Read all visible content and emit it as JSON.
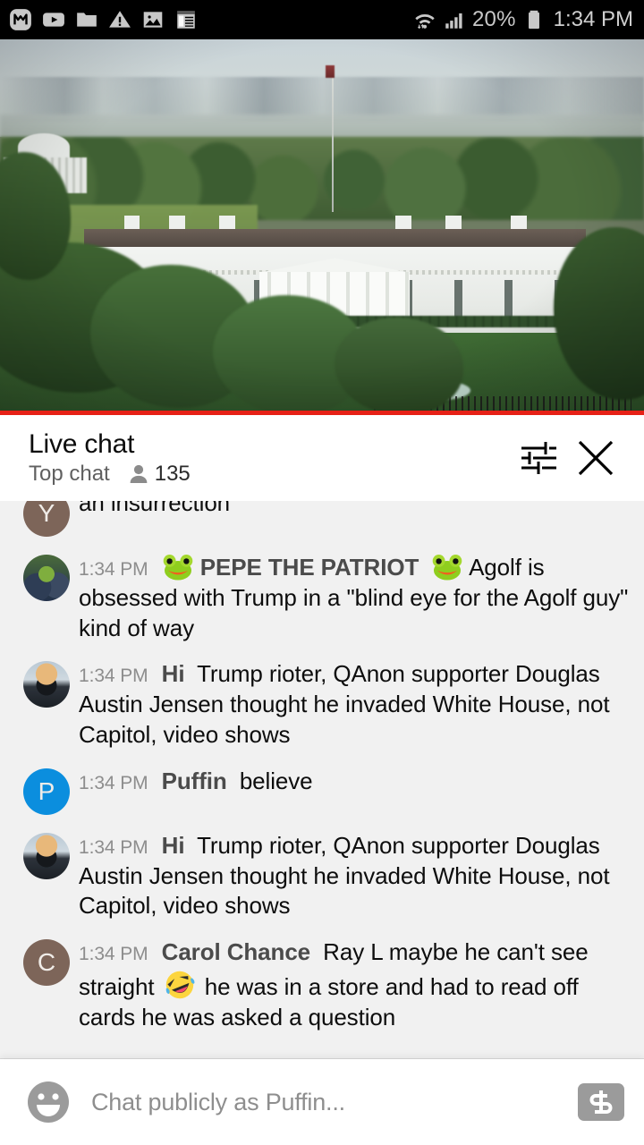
{
  "status_bar": {
    "left_icons": [
      "messenger-icon",
      "youtube-icon",
      "folder-icon",
      "warning-triangle-icon",
      "photo-icon",
      "notepad-icon"
    ],
    "wifi_icon": "wifi-icon",
    "signal_icon": "cell-signal-icon",
    "battery_percent": "20%",
    "battery_icon": "battery-icon",
    "clock": "1:34 PM",
    "background": "#000000",
    "text_color": "#c8c8c8"
  },
  "video": {
    "description": "White House live stream",
    "progress_bar_color": "#e62117",
    "progress_percent": 100
  },
  "chat_header": {
    "title": "Live chat",
    "subtitle": "Top chat",
    "viewer_count": "135",
    "viewer_icon": "person-icon",
    "settings_icon": "tune-sliders-icon",
    "close_icon": "close-x-icon"
  },
  "messages": [
    {
      "clipped": true,
      "avatar_type": "letter",
      "avatar_letter": "Y",
      "avatar_color": "#7d6559",
      "timestamp": "",
      "author": "",
      "text": "an insurrection"
    },
    {
      "clipped": false,
      "avatar_type": "photo-frog",
      "avatar_letter": "",
      "avatar_color": "",
      "timestamp": "1:34 PM",
      "author": "PEPE THE PATRIOT",
      "author_badges": [
        "frog-emoji",
        "frog-emoji"
      ],
      "text": "Agolf is obsessed with Trump in a \"blind eye for the Agolf guy\" kind of way"
    },
    {
      "clipped": false,
      "avatar_type": "photo-trump",
      "avatar_letter": "",
      "avatar_color": "",
      "timestamp": "1:34 PM",
      "author": "Hi",
      "text": "Trump rioter, QAnon supporter Douglas Austin Jensen thought he invaded White House, not Capitol, video shows"
    },
    {
      "clipped": false,
      "avatar_type": "letter",
      "avatar_letter": "P",
      "avatar_color": "#0b8ede",
      "timestamp": "1:34 PM",
      "author": "Puffin",
      "text": "believe"
    },
    {
      "clipped": false,
      "avatar_type": "photo-trump",
      "avatar_letter": "",
      "avatar_color": "",
      "timestamp": "1:34 PM",
      "author": "Hi",
      "text": "Trump rioter, QAnon supporter Douglas Austin Jensen thought he invaded White House, not Capitol, video shows"
    },
    {
      "clipped": false,
      "avatar_type": "letter",
      "avatar_letter": "C",
      "avatar_color": "#7d6559",
      "timestamp": "1:34 PM",
      "author": "Carol Chance",
      "text_before_emoji": "Ray L maybe he can't see straight ",
      "inline_emoji": "rofl-emoji",
      "text_after_emoji": "he was in a store and had to read off cards he was asked a question"
    }
  ],
  "input_bar": {
    "emoji_icon": "emoji-smiley-icon",
    "placeholder": "Chat publicly as Puffin...",
    "superchat_icon": "dollar-superchat-icon",
    "superchat_color": "#9b9b9b"
  },
  "colors": {
    "chat_background": "#f1f1f1",
    "panel_background": "#ffffff",
    "timestamp_text": "#8d8d8d",
    "author_text": "#4b4b4b",
    "message_text": "#0d0d0d"
  }
}
